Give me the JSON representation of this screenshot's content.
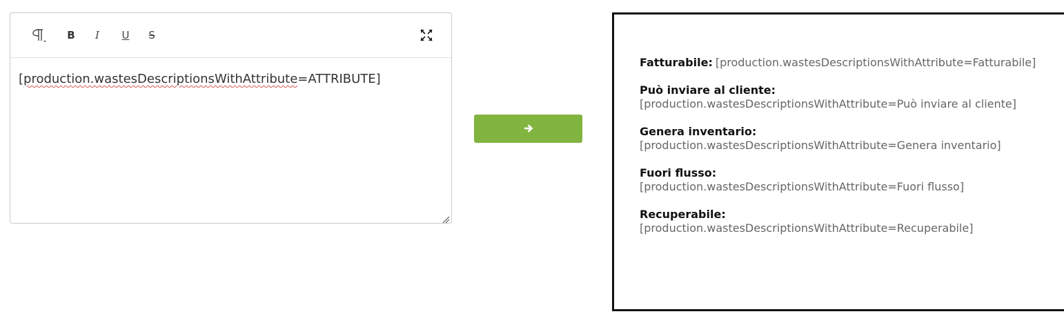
{
  "editor": {
    "toolbar": {
      "paragraph_icon": "paragraph-icon",
      "bold_label": "B",
      "italic_label": "I",
      "underline_label": "U",
      "strike_label": "S",
      "fullscreen_icon": "fullscreen-icon"
    },
    "content_prefix": "[",
    "content_misspelled": "production.wastesDescriptionsWithAttribute",
    "content_suffix": "=ATTRIBUTE]"
  },
  "arrow_button": {
    "icon": "arrow-right-icon",
    "color": "#82b440"
  },
  "preview": {
    "fields": [
      {
        "label": "Fatturabile:",
        "value": "[production.wastesDescriptionsWithAttribute=Fatturabile]"
      },
      {
        "label": "Può inviare al cliente:",
        "value": "[production.wastesDescriptionsWithAttribute=Può inviare al cliente]"
      },
      {
        "label": "Genera inventario:",
        "value": "[production.wastesDescriptionsWithAttribute=Genera inventario]"
      },
      {
        "label": "Fuori flusso:",
        "value": "[production.wastesDescriptionsWithAttribute=Fuori flusso]"
      },
      {
        "label": "Recuperabile:",
        "value": "[production.wastesDescriptionsWithAttribute=Recuperabile]"
      }
    ]
  }
}
